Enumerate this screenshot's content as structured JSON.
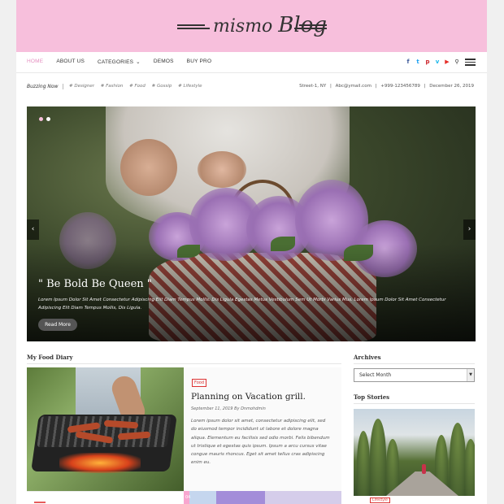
{
  "brand": {
    "logo_text_1": "mismo",
    "logo_text_2": "Blog"
  },
  "nav": {
    "items": [
      {
        "label": "Home",
        "active": true
      },
      {
        "label": "About Us"
      },
      {
        "label": "Categories"
      },
      {
        "label": "Demos"
      },
      {
        "label": "Buy Pro"
      }
    ],
    "social_icons": [
      "facebook-icon",
      "twitter-icon",
      "pinterest-icon",
      "vimeo-icon",
      "youtube-icon",
      "search-icon",
      "menu-icon"
    ]
  },
  "buzz": {
    "label": "Buzzing Now",
    "tags": [
      "# Designer",
      "# Fashion",
      "# Food",
      "# Gossip",
      "# Lifestyle"
    ],
    "contact": [
      "Street-1, NY",
      "|",
      "Abc@ymail.com",
      "|",
      "+999-123456789",
      "|",
      "December 26, 2019"
    ]
  },
  "slider": {
    "title": "\" Be Bold Be Queen \"",
    "excerpt": "Lorem Ipsum Dolor Sit Amet Consectetur Adipiscing Elit Diam Tempus Mollis. Dis Ligula Egestas Metus Vestibulum Sem Ut Morbi Varius Mus. Lorem Ipsum Dolor Sit Amet Consectetur Adipiscing Elit Diam Tempus Mollis, Dis Ligula.",
    "button": "Read More",
    "prev": "‹",
    "next": "›"
  },
  "main": {
    "section_title": "My Food Diary",
    "post": {
      "category": "Food",
      "title": "Planning on Vacation grill.",
      "date": "September 11, 2019",
      "author_prefix": "By",
      "author": "Dnmohdmin",
      "body": "Lorem ipsum dolor sit amet, consectetur adipiscing elit, sed do eiusmod tempor incididunt ut labore et dolore magna aliqua. Elementum eu facilisis sed odio morbi. Felis bibendum ut tristique et egestas quis ipsum. Ipsum a arcu cursus vitae congue mauris rhoncus. Eget sit amet tellus cras adipiscing enim eu."
    },
    "next_post_badge": "04"
  },
  "sidebar": {
    "archives_title": "Archives",
    "archives_select": "Select Month",
    "top_stories_title": "Top Stories",
    "top_story_tag": "Lifestyle"
  },
  "colors": {
    "header_pink": "#f7bfdc",
    "accent": "#e58fc0",
    "tag_red": "#dd3333"
  }
}
